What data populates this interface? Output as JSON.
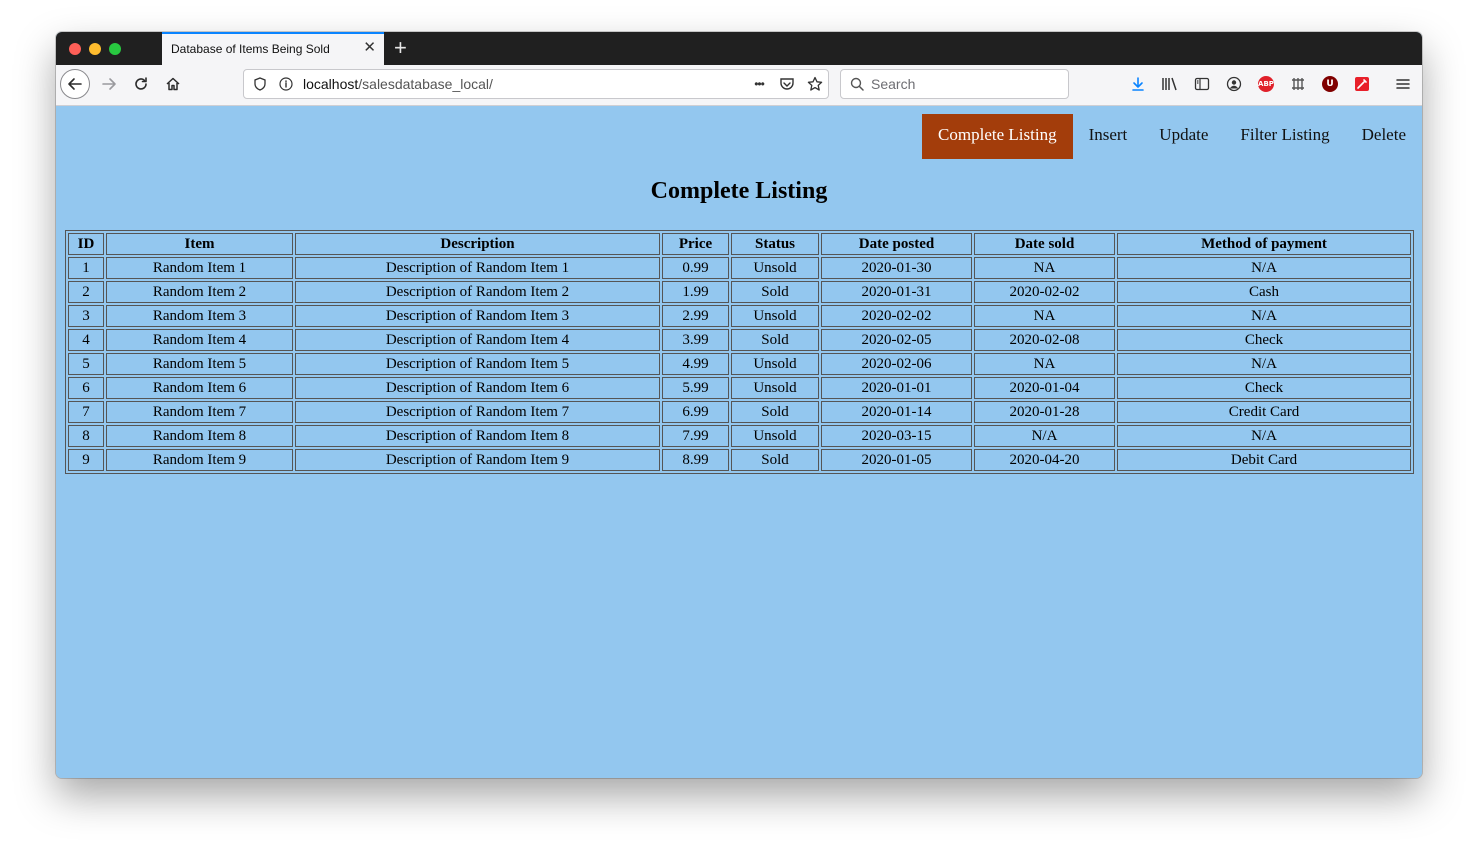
{
  "browser": {
    "tab_title": "Database of Items Being Sold",
    "tab_close": "✕",
    "new_tab": "+",
    "url_host": "localhost",
    "url_path": "/salesdatabase_local/",
    "search_placeholder": "Search",
    "more_dots": "•••"
  },
  "nav": {
    "items": [
      {
        "label": "Complete Listing",
        "active": true
      },
      {
        "label": "Insert",
        "active": false
      },
      {
        "label": "Update",
        "active": false
      },
      {
        "label": "Filter Listing",
        "active": false
      },
      {
        "label": "Delete",
        "active": false
      }
    ],
    "active_color": "#a33d0b"
  },
  "page": {
    "heading": "Complete Listing",
    "background": "#93c7ef"
  },
  "table": {
    "columns": [
      "ID",
      "Item",
      "Description",
      "Price",
      "Status",
      "Date posted",
      "Date sold",
      "Method of payment"
    ],
    "rows": [
      [
        "1",
        "Random Item 1",
        "Description of Random Item 1",
        "0.99",
        "Unsold",
        "2020-01-30",
        "NA",
        "N/A"
      ],
      [
        "2",
        "Random Item 2",
        "Description of Random Item 2",
        "1.99",
        "Sold",
        "2020-01-31",
        "2020-02-02",
        "Cash"
      ],
      [
        "3",
        "Random Item 3",
        "Description of Random Item 3",
        "2.99",
        "Unsold",
        "2020-02-02",
        "NA",
        "N/A"
      ],
      [
        "4",
        "Random Item 4",
        "Description of Random Item 4",
        "3.99",
        "Sold",
        "2020-02-05",
        "2020-02-08",
        "Check"
      ],
      [
        "5",
        "Random Item 5",
        "Description of Random Item 5",
        "4.99",
        "Unsold",
        "2020-02-06",
        "NA",
        "N/A"
      ],
      [
        "6",
        "Random Item 6",
        "Description of Random Item 6",
        "5.99",
        "Unsold",
        "2020-01-01",
        "2020-01-04",
        "Check"
      ],
      [
        "7",
        "Random Item 7",
        "Description of Random Item 7",
        "6.99",
        "Sold",
        "2020-01-14",
        "2020-01-28",
        "Credit Card"
      ],
      [
        "8",
        "Random Item 8",
        "Description of Random Item 8",
        "7.99",
        "Unsold",
        "2020-03-15",
        "N/A",
        "N/A"
      ],
      [
        "9",
        "Random Item 9",
        "Description of Random Item 9",
        "8.99",
        "Sold",
        "2020-01-05",
        "2020-04-20",
        "Debit Card"
      ]
    ]
  },
  "icons": {
    "abp_text": "ABP",
    "ublock_text": "U"
  }
}
